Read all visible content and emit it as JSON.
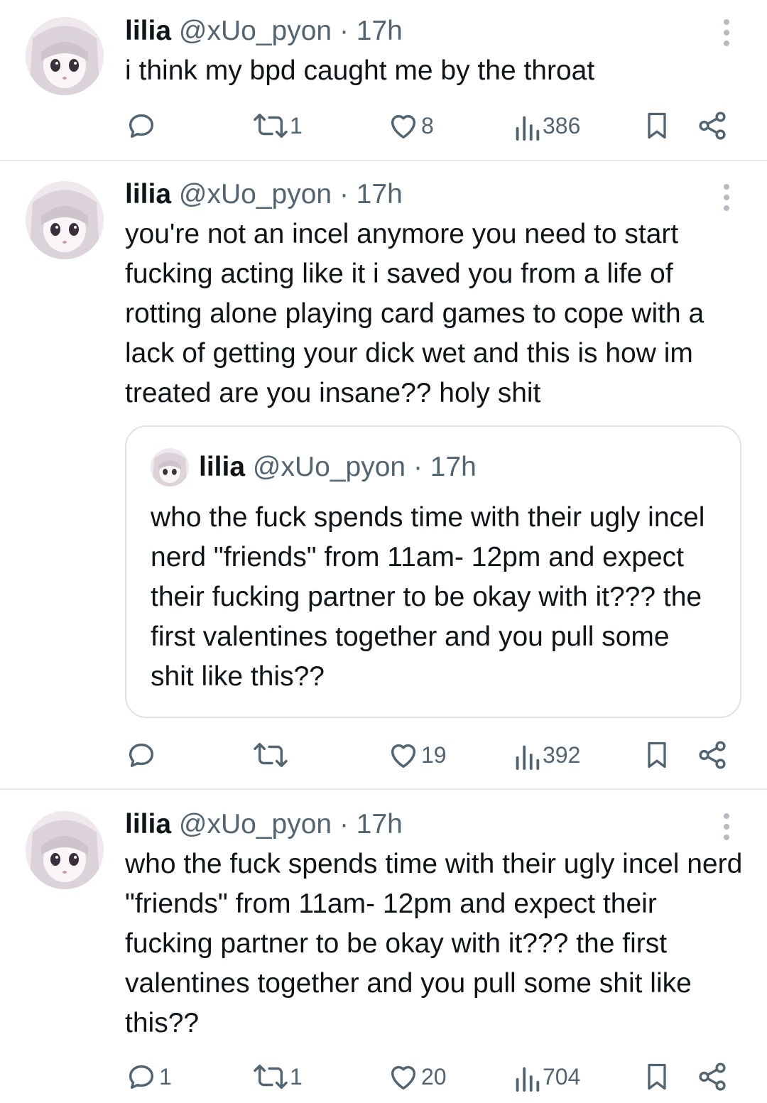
{
  "tweets": [
    {
      "name": "lilia",
      "handle": "@xUo_pyon",
      "dot": "·",
      "time": "17h",
      "text": "i think my bpd caught me by the throat",
      "replies": "",
      "reposts": "1",
      "likes": "8",
      "views": "386"
    },
    {
      "name": "lilia",
      "handle": "@xUo_pyon",
      "dot": "·",
      "time": "17h",
      "text": "you're not an incel anymore you need to start fucking acting like it i saved you from a life of rotting alone playing card games to cope with a lack of getting your dick wet and this is how im treated are you insane?? holy shit",
      "quote": {
        "name": "lilia",
        "handle": "@xUo_pyon",
        "dot": "·",
        "time": "17h",
        "text": "who the fuck spends time with their ugly incel nerd \"friends\" from 11am- 12pm and expect their fucking partner to be okay with it??? the first valentines together and you pull some shit like this??"
      },
      "replies": "",
      "reposts": "",
      "likes": "19",
      "views": "392"
    },
    {
      "name": "lilia",
      "handle": "@xUo_pyon",
      "dot": "·",
      "time": "17h",
      "text": "who the fuck spends time with their ugly incel nerd \"friends\" from 11am- 12pm and expect their fucking partner to be okay with it??? the first valentines together and you pull some shit like this??",
      "replies": "1",
      "reposts": "1",
      "likes": "20",
      "views": "704"
    }
  ],
  "colors": {
    "text": "#0f1419",
    "secondary": "#536471",
    "divider": "#e6e9ec",
    "quote_border": "#dfe3e6"
  },
  "icons": [
    "avatar",
    "more-icon",
    "reply-icon",
    "repost-icon",
    "like-icon",
    "views-icon",
    "bookmark-icon",
    "share-icon"
  ]
}
